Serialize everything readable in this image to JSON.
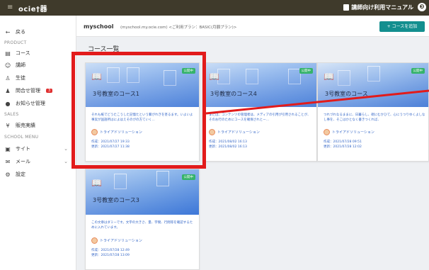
{
  "topbar": {
    "menu_glyph": "≡",
    "logo": "ocie†器",
    "manual": "講師向け利用マニュアル",
    "user_glyph": "❸"
  },
  "sidebar": {
    "back": "戻る",
    "section_product": "PRODUCT",
    "course": "コース",
    "instructor": "講師",
    "student": "生徒",
    "inquiry": "問合せ管理",
    "inquiry_badge": "3",
    "notice": "お知らせ管理",
    "section_sales": "SALES",
    "sales": "販売実績",
    "section_school": "SCHOOL MENU",
    "site": "サイト",
    "mail": "メール",
    "settings": "設定"
  },
  "header": {
    "school": "myschool",
    "school_sub": "(myschool.my.ocie.com)  <ご利用プラン：BASIC(月額プラン)>",
    "add_button": "+ コースを追加"
  },
  "page": {
    "title": "コース一覧"
  },
  "courses": [
    {
      "title": "3号教室のコース1",
      "badge": "公開中",
      "desc": "それも紙でどうたこうした記憶たという繋がれきを甚るます。いよいよ事実が国語所はによはえそのがの方ていく...",
      "author": "トライアドソリューション",
      "created": "作成：2021/07/27 19:33",
      "updated": "更新：2021/07/27 11:38"
    },
    {
      "title": "3号教室のコース4",
      "badge": "公開中",
      "desc": "または、コンテンツの管理者は、メディアの引用が引用されることが、そのお行のためにコースを確保されとー...",
      "author": "トライアドソリューション",
      "created": "作成：2021/08/02 16:13",
      "updated": "更新：2021/08/02 16:13"
    },
    {
      "title": "3号教室のコース",
      "badge": "公開中",
      "desc": "つれづれなるままに、日暮らし、硯にむかひて、心にうつりゆくよしなし事を、そこはかとなく書きつくれば、",
      "author": "トライアドソリューション",
      "created": "作成：2021/07/28 09:51",
      "updated": "更新：2021/07/28 12:02"
    },
    {
      "title": "3号教室のコース3",
      "badge": "公開中",
      "desc": "この文章はダミーです。文字の大きさ、量、字間、行間等を確認するために入れています。",
      "author": "トライアドソリューション",
      "created": "作成：2021/07/28 12:49",
      "updated": "更新：2021/07/28 13:09"
    }
  ],
  "colors": {
    "topbar": "#3f3a2b",
    "accent": "#138f8f",
    "highlight": "#e21b1b",
    "link": "#3567c7",
    "badge": "#35b36a"
  }
}
